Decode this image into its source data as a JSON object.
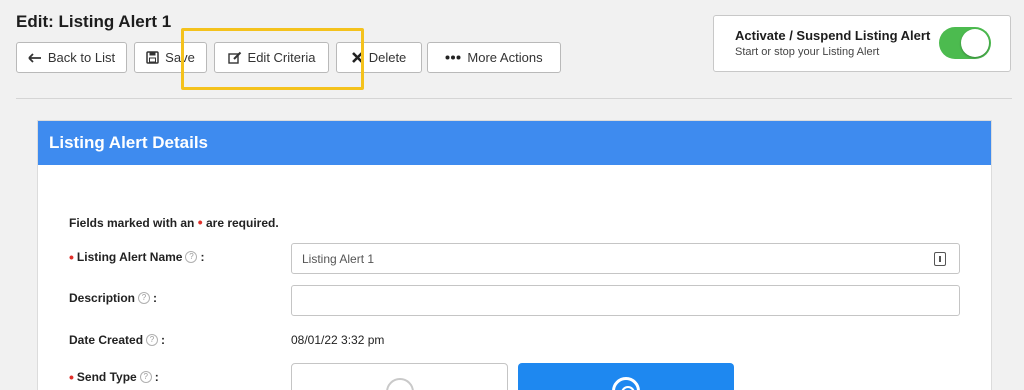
{
  "page": {
    "title": "Edit: Listing Alert 1"
  },
  "toolbar": {
    "back_label": "Back to List",
    "save_label": "Save",
    "edit_criteria_label": "Edit Criteria",
    "delete_label": "Delete",
    "more_actions_label": "More Actions"
  },
  "activate": {
    "title": "Activate / Suspend Listing Alert",
    "subtitle": "Start or stop your Listing Alert",
    "enabled": true,
    "on_color": "#4cbb4f"
  },
  "panel": {
    "title": "Listing Alert Details",
    "header_color": "#3e8bef"
  },
  "form": {
    "required_note_prefix": "Fields marked with an",
    "required_marker": "•",
    "required_note_suffix": "are required.",
    "name_label": "Listing Alert Name",
    "name_value": "Listing Alert 1",
    "description_label": "Description",
    "description_value": "",
    "date_created_label": "Date Created",
    "date_created_value": "08/01/22 3:32 pm",
    "send_type_label": "Send Type",
    "colon": ":",
    "help_glyph": "?"
  },
  "icons": {
    "back": "arrow-left-icon",
    "save": "floppy-disk-icon",
    "edit": "edit-pencil-icon",
    "delete": "x-icon",
    "more": "ellipsis-icon",
    "help": "question-icon",
    "input_action": "contact-card-icon"
  },
  "colors": {
    "highlight": "#f4c21d",
    "required": "#e0302a",
    "send_type_selected": "#1e88f0"
  }
}
